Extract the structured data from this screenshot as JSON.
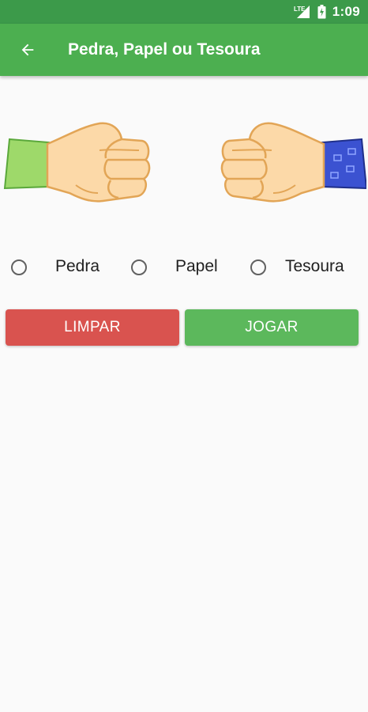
{
  "status_bar": {
    "network": "LTE",
    "time": "1:09"
  },
  "app_bar": {
    "title": "Pedra, Papel ou Tesoura",
    "back_icon": "arrow-back-icon"
  },
  "players": {
    "left_hand": "fist-icon",
    "right_hand": "fist-icon",
    "left_sleeve_color": "#9ed96a",
    "right_sleeve_color": "#3b52d1"
  },
  "options": [
    {
      "label": "Pedra",
      "selected": false
    },
    {
      "label": "Papel",
      "selected": false
    },
    {
      "label": "Tesoura",
      "selected": false
    }
  ],
  "buttons": {
    "clear_label": "LIMPAR",
    "play_label": "JOGAR"
  },
  "colors": {
    "primary": "#4caf50",
    "primary_dark": "#3c9a4a",
    "clear": "#d9534f",
    "play": "#5cb85c"
  }
}
